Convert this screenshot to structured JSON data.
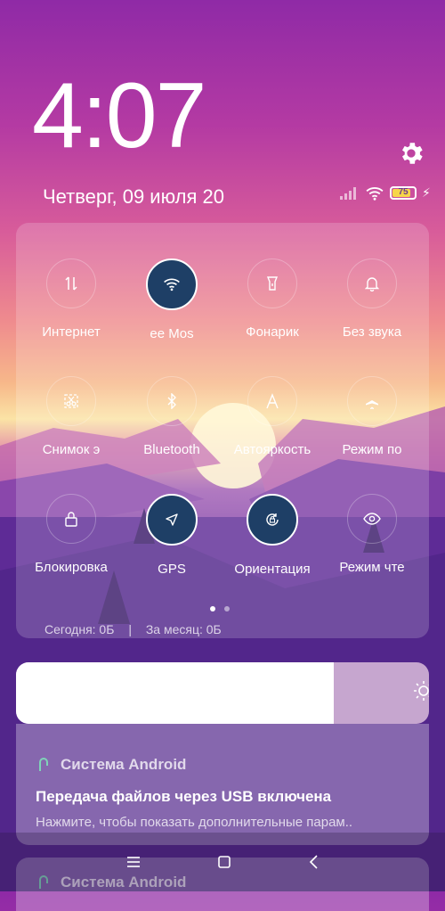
{
  "lockscreen": {
    "time": "4:07",
    "date": "Четверг, 09 июля 20",
    "battery": "75"
  },
  "quick_settings": {
    "tiles": [
      {
        "label": "Интернет",
        "icon": "data-transfer-icon",
        "active": false
      },
      {
        "label": "ee   Mos",
        "icon": "wifi-icon",
        "active": true
      },
      {
        "label": "Фонарик",
        "icon": "flashlight-icon",
        "active": false
      },
      {
        "label": "Без звука",
        "icon": "bell-icon",
        "active": false
      },
      {
        "label": "Снимок э",
        "icon": "screenshot-scissors-icon",
        "active": false
      },
      {
        "label": "Bluetooth",
        "icon": "bluetooth-icon",
        "active": false
      },
      {
        "label": "Автояркость",
        "icon": "auto-brightness-icon",
        "active": false
      },
      {
        "label": "Режим по",
        "icon": "airplane-icon",
        "active": false
      },
      {
        "label": "Блокировка",
        "icon": "lock-icon",
        "active": false
      },
      {
        "label": "GPS",
        "icon": "location-arrow-icon",
        "active": true
      },
      {
        "label": "Ориентация",
        "icon": "rotation-lock-icon",
        "active": true
      },
      {
        "label": "Режим чте",
        "icon": "eye-icon",
        "active": false
      }
    ],
    "page_count": 2,
    "active_page": 1
  },
  "data_usage": {
    "today": "Сегодня: 0Б",
    "separator": "|",
    "month": "За месяц: 0Б"
  },
  "brightness": {
    "level": 0.77
  },
  "notifications": [
    {
      "app": "Система Android",
      "title": "Передача файлов через USB включена",
      "body": "Нажмите, чтобы показать дополнительные парам.."
    },
    {
      "app": "Система Android"
    }
  ],
  "colors": {
    "active_tile": "#1e3f66",
    "battery_fill": "#f6d64a"
  }
}
